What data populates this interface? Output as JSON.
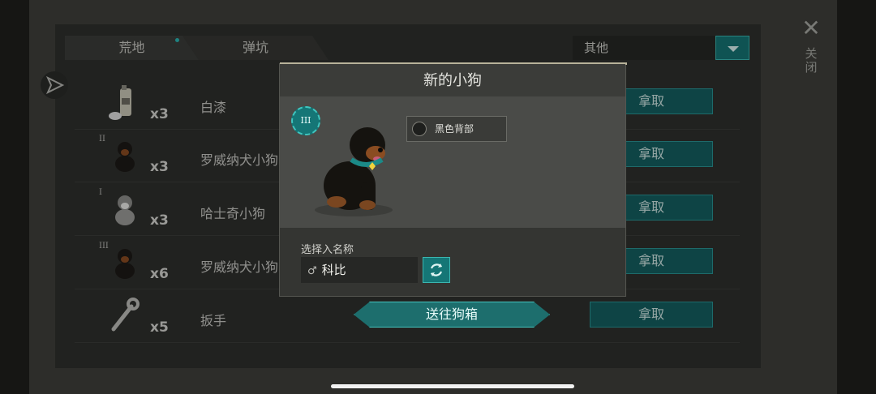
{
  "tabs": [
    {
      "label": "荒地"
    },
    {
      "label": "弹坑"
    }
  ],
  "filter": {
    "selected": "其他"
  },
  "close_label": "关闭",
  "items": [
    {
      "name": "白漆",
      "qty": "x3",
      "tier": "",
      "icon": "spray-paint-can-icon",
      "action": "拿取"
    },
    {
      "name": "罗威纳犬小狗",
      "qty": "x3",
      "tier": "II",
      "icon": "rottweiler-puppy-icon",
      "action": "拿取"
    },
    {
      "name": "哈士奇小狗",
      "qty": "x3",
      "tier": "I",
      "icon": "husky-puppy-icon",
      "action": "拿取"
    },
    {
      "name": "罗威纳犬小狗",
      "qty": "x6",
      "tier": "III",
      "icon": "rottweiler-puppy-icon",
      "action": "拿取"
    },
    {
      "name": "扳手",
      "qty": "x5",
      "tier": "",
      "icon": "wrench-icon",
      "action": "拿取"
    }
  ],
  "modal": {
    "title": "新的小狗",
    "rank": "III",
    "trait": "黑色背部",
    "name_label": "选择入名称",
    "gender": "♂",
    "dog_name": "科比",
    "send_button": "送往狗箱"
  },
  "colors": {
    "accent": "#157676",
    "panel": "#2f302d",
    "text": "#c7c7c3"
  }
}
